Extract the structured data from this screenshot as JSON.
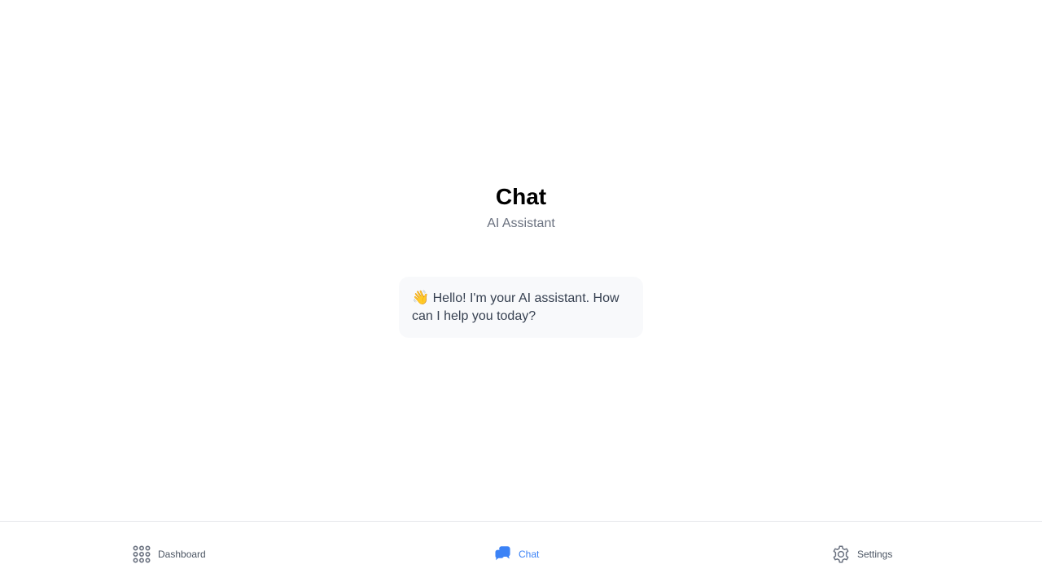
{
  "page": {
    "title": "Chat",
    "subtitle": "AI Assistant"
  },
  "messages": [
    {
      "emoji": "👋",
      "text": "Hello! I'm your AI assistant. How can I help you today?"
    }
  ],
  "bottom_nav": {
    "items": [
      {
        "label": "Dashboard",
        "icon": "grid-dots-icon",
        "active": false
      },
      {
        "label": "Chat",
        "icon": "chat-bubbles-icon",
        "active": true
      },
      {
        "label": "Settings",
        "icon": "gear-icon",
        "active": false
      }
    ]
  },
  "colors": {
    "accent": "#3b82f6",
    "nav_text": "#4b5563",
    "icon_gray": "#6b7280",
    "subtitle": "#6b7280",
    "bubble_bg": "#f8f9fb",
    "border": "#e5e7eb"
  }
}
